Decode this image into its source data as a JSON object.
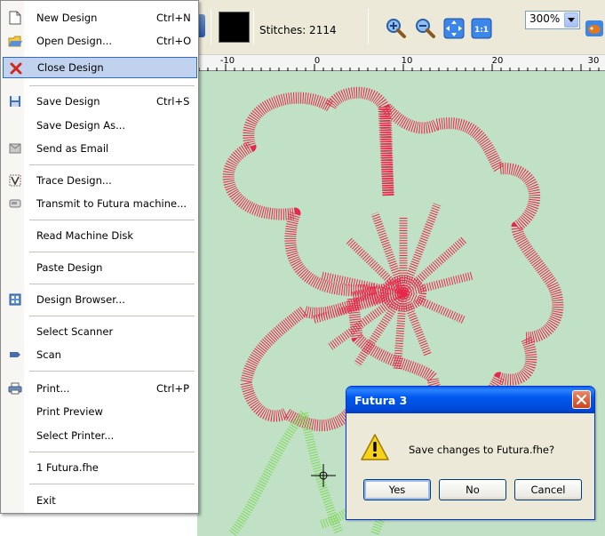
{
  "menu": {
    "items": [
      {
        "label": "New Design",
        "shortcut": "Ctrl+N",
        "icon": "new-document-icon"
      },
      {
        "label": "Open Design...",
        "shortcut": "Ctrl+O",
        "icon": "open-folder-icon"
      },
      {
        "label": "Close Design",
        "shortcut": "",
        "icon": "close-x-icon"
      },
      {
        "label": "Save Design",
        "shortcut": "Ctrl+S",
        "icon": "floppy-disk-icon"
      },
      {
        "label": "Save Design As...",
        "shortcut": "",
        "icon": ""
      },
      {
        "label": "Send as Email",
        "shortcut": "",
        "icon": "email-icon"
      },
      {
        "label": "Trace Design...",
        "shortcut": "",
        "icon": "trace-icon"
      },
      {
        "label": "Transmit to Futura machine...",
        "shortcut": "",
        "icon": "machine-icon"
      },
      {
        "label": "Read Machine Disk",
        "shortcut": "",
        "icon": ""
      },
      {
        "label": "Paste Design",
        "shortcut": "",
        "icon": ""
      },
      {
        "label": "Design Browser...",
        "shortcut": "",
        "icon": "browser-icon"
      },
      {
        "label": "Select Scanner",
        "shortcut": "",
        "icon": ""
      },
      {
        "label": "Scan",
        "shortcut": "",
        "icon": "scanner-icon"
      },
      {
        "label": "Print...",
        "shortcut": "Ctrl+P",
        "icon": "printer-icon"
      },
      {
        "label": "Print Preview",
        "shortcut": "",
        "icon": ""
      },
      {
        "label": "Select Printer...",
        "shortcut": "",
        "icon": ""
      },
      {
        "label": "1 Futura.fhe",
        "shortcut": "",
        "icon": ""
      },
      {
        "label": "Exit",
        "shortcut": "",
        "icon": ""
      }
    ]
  },
  "toolbar": {
    "stitches_label": "Stitches: 2114",
    "zoom_value": "300%",
    "one_to_one_label": "1:1",
    "current_color": "#000000"
  },
  "ruler": {
    "ticks": [
      "-10",
      "0",
      "10",
      "20",
      "30"
    ]
  },
  "dialog": {
    "title": "Futura 3",
    "message": "Save changes to Futura.fhe?",
    "yes_label": "Yes",
    "no_label": "No",
    "cancel_label": "Cancel"
  },
  "colors": {
    "canvas_bg": "#c1e1c6",
    "stitch_red": "#e8274a",
    "stitch_green": "#7ed957",
    "menu_highlight": "#c1d2ee",
    "dialog_title": "#0054e3"
  }
}
